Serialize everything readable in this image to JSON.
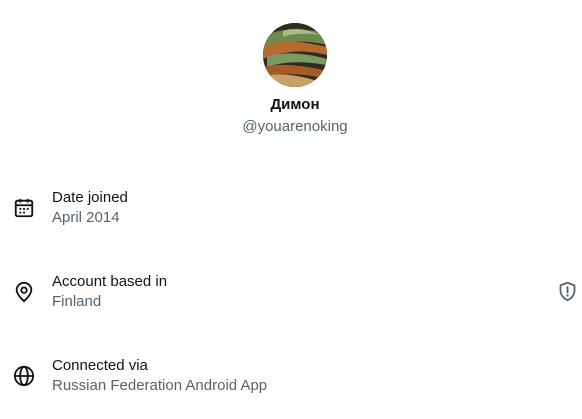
{
  "profile": {
    "display_name": "Димон",
    "handle": "@youarenoking"
  },
  "details": [
    {
      "icon": "calendar-icon",
      "label": "Date joined",
      "value": "April 2014"
    },
    {
      "icon": "location-pin-icon",
      "label": "Account based in",
      "value": "Finland",
      "trailing_icon": "shield-alert-icon"
    },
    {
      "icon": "globe-icon",
      "label": "Connected via",
      "value": "Russian Federation Android App"
    }
  ],
  "colors": {
    "primary_text": "#0f1419",
    "secondary_text": "#536471",
    "background": "#ffffff"
  }
}
